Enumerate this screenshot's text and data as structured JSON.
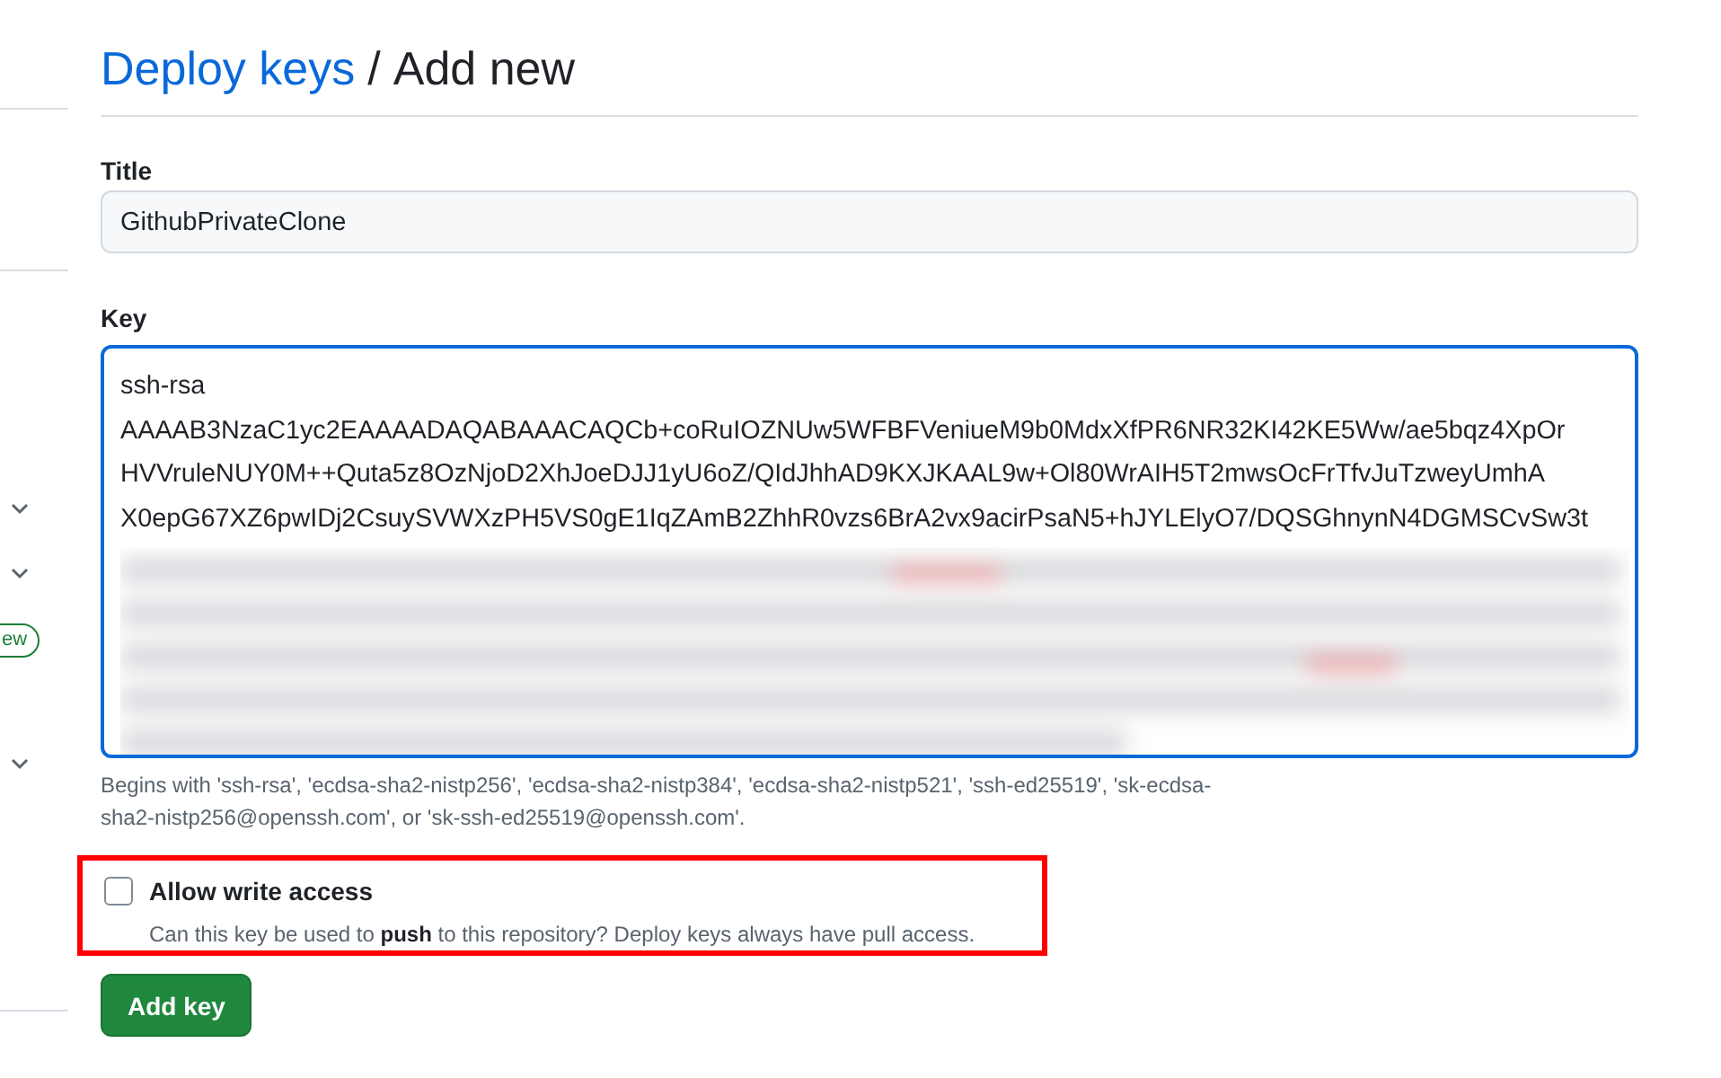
{
  "sidebar": {
    "items": [
      {
        "kind": "chevron"
      },
      {
        "kind": "chevron"
      },
      {
        "kind": "badge",
        "label": "ew"
      },
      {
        "kind": "chevron"
      }
    ]
  },
  "header": {
    "link": "Deploy keys",
    "separator": "/",
    "title": "Add new"
  },
  "title_field": {
    "label": "Title",
    "value": "GithubPrivateClone"
  },
  "key_field": {
    "label": "Key",
    "lines": [
      "ssh-rsa",
      "AAAAB3NzaC1yc2EAAAADAQABAAACAQCb+coRuIOZNUw5WFBFVeniueM9b0MdxXfPR6NR32KI42KE5Ww/ae5bqz4XpOr",
      "HVVruleNUY0M++Quta5z8OzNjoD2XhJoeDJJ1yU6oZ/QIdJhhAD9KXJKAAL9w+Ol80WrAIH5T2mwsOcFrTfvJuTzweyUmhA",
      "X0epG67XZ6pwIDj2CsuySVWXzPH5VS0gE1IqZAmB2ZhhR0vzs6BrA2vx9acirPsaN5+hJYLElyO7/DQSGhnynN4DGMSCvSw3t"
    ],
    "redacted": true,
    "hint": "Begins with 'ssh-rsa', 'ecdsa-sha2-nistp256', 'ecdsa-sha2-nistp384', 'ecdsa-sha2-nistp521', 'ssh-ed25519', 'sk-ecdsa-sha2-nistp256@openssh.com', or 'sk-ssh-ed25519@openssh.com'."
  },
  "write_access": {
    "label": "Allow write access",
    "checked": false,
    "highlighted": true,
    "description": "Can this key be used to **push** to this repository? Deploy keys always have pull access."
  },
  "submit": {
    "label": "Add key"
  }
}
